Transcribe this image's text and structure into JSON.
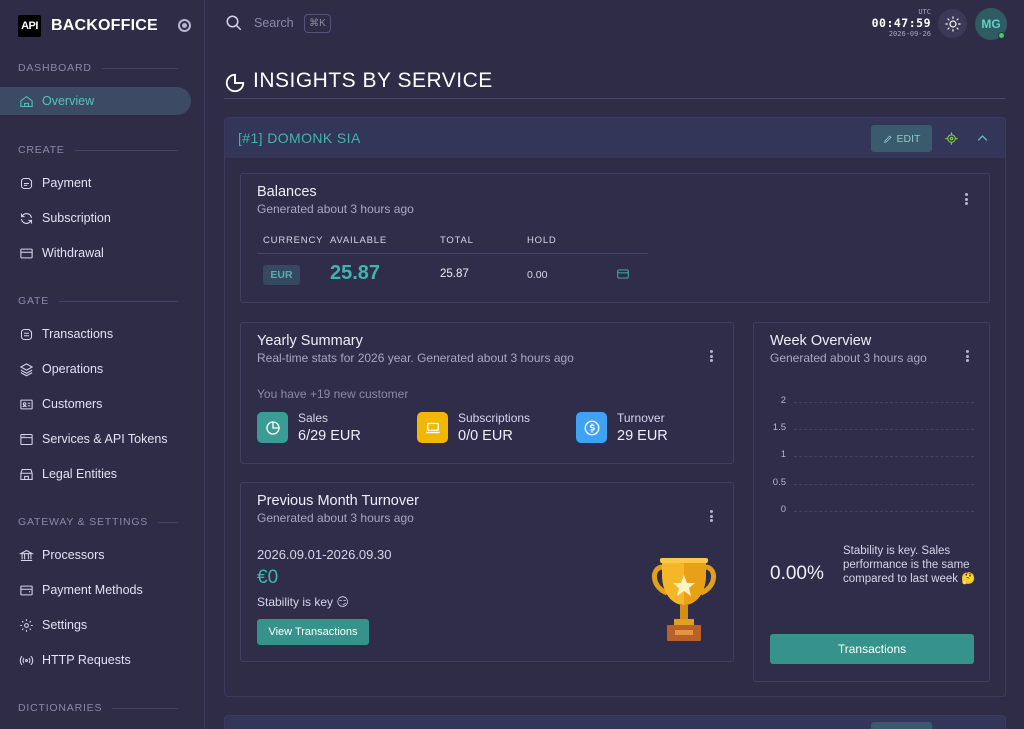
{
  "brand": {
    "logo": "API",
    "name": "BACKOFFICE"
  },
  "sidebar": {
    "sections": [
      {
        "label": "DASHBOARD"
      },
      {
        "label": "CREATE"
      },
      {
        "label": "GATE"
      },
      {
        "label": "GATEWAY & SETTINGS"
      },
      {
        "label": "DICTIONARIES"
      }
    ],
    "items": [
      {
        "label": "Overview",
        "icon": "home-icon",
        "active": true
      },
      {
        "label": "Payment",
        "icon": "payment-icon"
      },
      {
        "label": "Subscription",
        "icon": "refresh-icon"
      },
      {
        "label": "Withdrawal",
        "icon": "wallet-icon"
      },
      {
        "label": "Transactions",
        "icon": "transactions-icon"
      },
      {
        "label": "Operations",
        "icon": "layers-icon"
      },
      {
        "label": "Customers",
        "icon": "id-card-icon"
      },
      {
        "label": "Services & API Tokens",
        "icon": "browser-icon"
      },
      {
        "label": "Legal Entities",
        "icon": "building-icon"
      },
      {
        "label": "Processors",
        "icon": "bank-icon"
      },
      {
        "label": "Payment Methods",
        "icon": "wallet-icon"
      },
      {
        "label": "Settings",
        "icon": "gear-icon"
      },
      {
        "label": "HTTP Requests",
        "icon": "broadcast-icon"
      }
    ]
  },
  "header": {
    "search_placeholder": "Search",
    "shortcut": "⌘K",
    "timezone": "UTC",
    "time": "00:47:59",
    "date": "2026-09-26",
    "avatar_initials": "MG"
  },
  "page": {
    "title": "INSIGHTS BY SERVICE"
  },
  "service": {
    "title": "[#1] DOMONK SIA",
    "edit_label": "EDIT",
    "balances": {
      "title": "Balances",
      "subtitle": "Generated about 3 hours ago",
      "columns": [
        "CURRENCY",
        "AVAILABLE",
        "TOTAL",
        "HOLD"
      ],
      "row": {
        "currency": "EUR",
        "available": "25.87",
        "total": "25.87",
        "hold": "0.00"
      }
    },
    "yearly": {
      "title": "Yearly Summary",
      "subtitle": "Real-time stats for 2026 year. Generated about 3 hours ago",
      "note": "You have +19 new customer",
      "stats": [
        {
          "label": "Sales",
          "value": "6/29 EUR",
          "color": "#3a9c94",
          "icon": "pie-chart-icon"
        },
        {
          "label": "Subscriptions",
          "value": "0/0 EUR",
          "color": "#f2b705",
          "icon": "laptop-icon"
        },
        {
          "label": "Turnover",
          "value": "29 EUR",
          "color": "#3fa2f5",
          "icon": "dollar-icon"
        }
      ]
    },
    "prev_month": {
      "title": "Previous Month Turnover",
      "subtitle": "Generated about 3 hours ago",
      "range": "2026.09.01-2026.09.30",
      "amount": "€0",
      "stability": "Stability is key 😏",
      "button": "View Transactions"
    },
    "week": {
      "title": "Week Overview",
      "subtitle": "Generated about 3 hours ago",
      "y_ticks": [
        "2",
        "1.5",
        "1",
        "0.5",
        "0"
      ],
      "percent": "0.00%",
      "text": "Stability is key. Sales performance is the same compared to last week 🤔",
      "button": "Transactions"
    }
  },
  "colors": {
    "accent": "#3fb6ad",
    "background": "#2f2c48",
    "active_nav": "#3c4a63"
  }
}
